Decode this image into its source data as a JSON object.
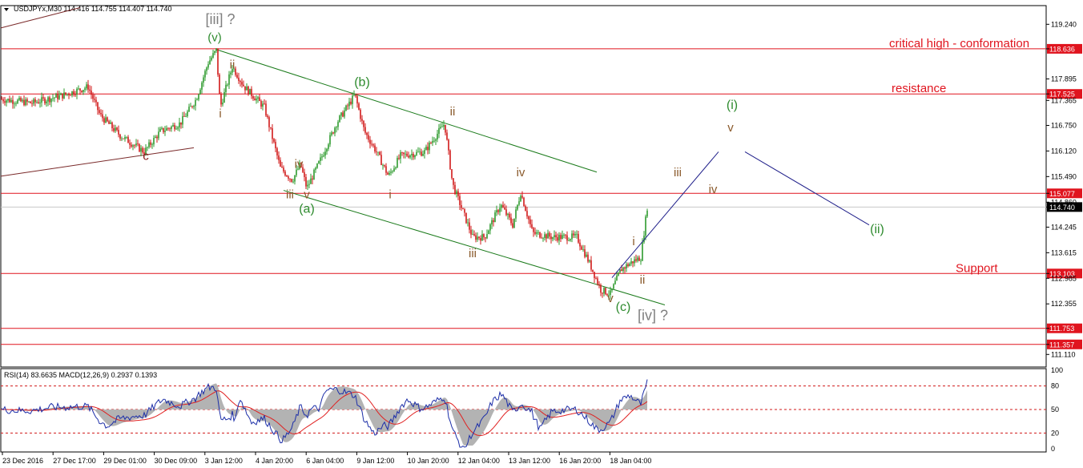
{
  "header": {
    "symbol_line": "USDJPYx,M30  114.416 114.755 114.407 114.740",
    "sub_line": "RSI(14) 83.6635  MACD(12,26,9) 0.2937 0.1393"
  },
  "chart_data": {
    "type": "candlestick",
    "symbol": "USDJPYx",
    "timeframe": "M30",
    "ohlc": {
      "open": 114.416,
      "high": 114.755,
      "low": 114.407,
      "close": 114.74
    },
    "x_tick_labels": [
      "23 Dec 2016",
      "27 Dec 17:00",
      "29 Dec 01:00",
      "30 Dec 09:00",
      "3 Jan 12:00",
      "4 Jan 20:00",
      "6 Jan 04:00",
      "9 Jan 12:00",
      "10 Jan 20:00",
      "12 Jan 04:00",
      "13 Jan 12:00",
      "16 Jan 20:00",
      "18 Jan 04:00"
    ],
    "y_range": [
      110.8,
      119.7
    ],
    "y_tick_labels": [
      "119.240",
      "118.636",
      "117.895",
      "117.525",
      "117.365",
      "116.750",
      "116.120",
      "115.490",
      "115.077",
      "114.860",
      "114.740",
      "114.245",
      "113.615",
      "113.103",
      "112.985",
      "112.355",
      "111.753",
      "111.357",
      "111.110"
    ],
    "horizontal_levels": [
      {
        "price": 118.636,
        "label": "118.636",
        "annotation": "critical high - conformation",
        "color": "#e0141e"
      },
      {
        "price": 117.525,
        "label": "117.525",
        "annotation": "resistance",
        "color": "#e0141e"
      },
      {
        "price": 115.077,
        "label": "115.077",
        "annotation": "",
        "color": "#e0141e"
      },
      {
        "price": 113.103,
        "label": "113.103",
        "annotation": "Support",
        "color": "#e0141e"
      },
      {
        "price": 111.753,
        "label": "111.753",
        "annotation": "",
        "color": "#e0141e"
      },
      {
        "price": 111.357,
        "label": "111.357",
        "annotation": "",
        "color": "#e0141e"
      }
    ],
    "current_price": {
      "price": 114.74,
      "label": "114.740"
    },
    "price_path": [
      [
        0,
        117.4
      ],
      [
        40,
        117.3
      ],
      [
        80,
        117.5
      ],
      [
        110,
        117.7
      ],
      [
        125,
        117.0
      ],
      [
        150,
        116.5
      ],
      [
        180,
        116.1
      ],
      [
        200,
        116.6
      ],
      [
        225,
        116.8
      ],
      [
        245,
        117.4
      ],
      [
        260,
        118.3
      ],
      [
        270,
        118.6
      ],
      [
        275,
        117.2
      ],
      [
        290,
        118.2
      ],
      [
        305,
        117.7
      ],
      [
        330,
        117.2
      ],
      [
        350,
        115.7
      ],
      [
        365,
        115.4
      ],
      [
        375,
        115.8
      ],
      [
        383,
        115.2
      ],
      [
        400,
        115.9
      ],
      [
        420,
        116.8
      ],
      [
        443,
        117.5
      ],
      [
        455,
        116.6
      ],
      [
        470,
        116.1
      ],
      [
        485,
        115.5
      ],
      [
        500,
        116.0
      ],
      [
        530,
        116.1
      ],
      [
        555,
        116.8
      ],
      [
        565,
        115.3
      ],
      [
        590,
        114.0
      ],
      [
        605,
        114.0
      ],
      [
        625,
        114.8
      ],
      [
        640,
        114.3
      ],
      [
        650,
        115.1
      ],
      [
        665,
        114.1
      ],
      [
        690,
        114.0
      ],
      [
        720,
        114.0
      ],
      [
        735,
        113.4
      ],
      [
        750,
        112.7
      ],
      [
        762,
        112.6
      ],
      [
        775,
        113.2
      ],
      [
        790,
        113.4
      ],
      [
        800,
        113.5
      ],
      [
        808,
        114.74
      ]
    ],
    "wave_labels": [
      {
        "text": "[iii] ?",
        "x": 275,
        "price": 119.25,
        "color": "#7f7f7f",
        "size": 18
      },
      {
        "text": "(v)",
        "x": 268,
        "price": 118.82,
        "color": "#2e8b2e",
        "size": 15
      },
      {
        "text": "ii",
        "x": 290,
        "price": 118.15,
        "color": "#8a5a2b",
        "size": 15
      },
      {
        "text": "i",
        "x": 275,
        "price": 116.95,
        "color": "#8a5a2b",
        "size": 15
      },
      {
        "text": "c",
        "x": 182,
        "price": 115.9,
        "color": "#8a1f1f",
        "size": 15
      },
      {
        "text": "(b)",
        "x": 452,
        "price": 117.72,
        "color": "#2e8b2e",
        "size": 16
      },
      {
        "text": "ii",
        "x": 565,
        "price": 117.0,
        "color": "#8a5a2b",
        "size": 15
      },
      {
        "text": "iv",
        "x": 373,
        "price": 115.7,
        "color": "#8a5a2b",
        "size": 15
      },
      {
        "text": "iii",
        "x": 362,
        "price": 114.95,
        "color": "#8a5a2b",
        "size": 15
      },
      {
        "text": "v",
        "x": 383,
        "price": 114.95,
        "color": "#8a5a2b",
        "size": 15
      },
      {
        "text": "(a)",
        "x": 383,
        "price": 114.6,
        "color": "#2e8b2e",
        "size": 16
      },
      {
        "text": "i",
        "x": 487,
        "price": 114.95,
        "color": "#8a5a2b",
        "size": 15
      },
      {
        "text": "iv",
        "x": 650,
        "price": 115.5,
        "color": "#8a5a2b",
        "size": 15
      },
      {
        "text": "iii",
        "x": 590,
        "price": 113.5,
        "color": "#8a5a2b",
        "size": 15
      },
      {
        "text": "v",
        "x": 762,
        "price": 112.4,
        "color": "#8a5a2b",
        "size": 15
      },
      {
        "text": "(c)",
        "x": 778,
        "price": 112.18,
        "color": "#2e8b2e",
        "size": 16
      },
      {
        "text": "[iv] ?",
        "x": 815,
        "price": 111.95,
        "color": "#7f7f7f",
        "size": 18
      },
      {
        "text": "i",
        "x": 791,
        "price": 113.8,
        "color": "#8a5a2b",
        "size": 15
      },
      {
        "text": "ii",
        "x": 802,
        "price": 112.85,
        "color": "#8a5a2b",
        "size": 15
      },
      {
        "text": "iii",
        "x": 846,
        "price": 115.5,
        "color": "#8a5a2b",
        "size": 15
      },
      {
        "text": "iv",
        "x": 890,
        "price": 115.08,
        "color": "#8a5a2b",
        "size": 15
      },
      {
        "text": "v",
        "x": 912,
        "price": 116.6,
        "color": "#8a5a2b",
        "size": 15
      },
      {
        "text": "(i)",
        "x": 914,
        "price": 117.15,
        "color": "#2e8b2e",
        "size": 16
      },
      {
        "text": "(ii)",
        "x": 1095,
        "price": 114.1,
        "color": "#2e8b2e",
        "size": 16
      }
    ],
    "rsi": {
      "value": 83.6635,
      "levels": [
        80,
        50,
        20
      ],
      "y_tick_labels": [
        "100",
        "80",
        "50",
        "20",
        "0"
      ]
    },
    "macd": {
      "fast": 12,
      "slow": 26,
      "signal": 9,
      "main": 0.2937,
      "signal_value": 0.1393
    },
    "grid": false,
    "colors": {
      "bull": "#2e9b2e",
      "bear": "#d11a1a",
      "level": "#e0141e",
      "channel": "#1a7a1a",
      "projection": "#1f1f8a",
      "rsi": "#1c2ea8",
      "macd": "#b3b3b3",
      "signal": "#e02020"
    }
  }
}
